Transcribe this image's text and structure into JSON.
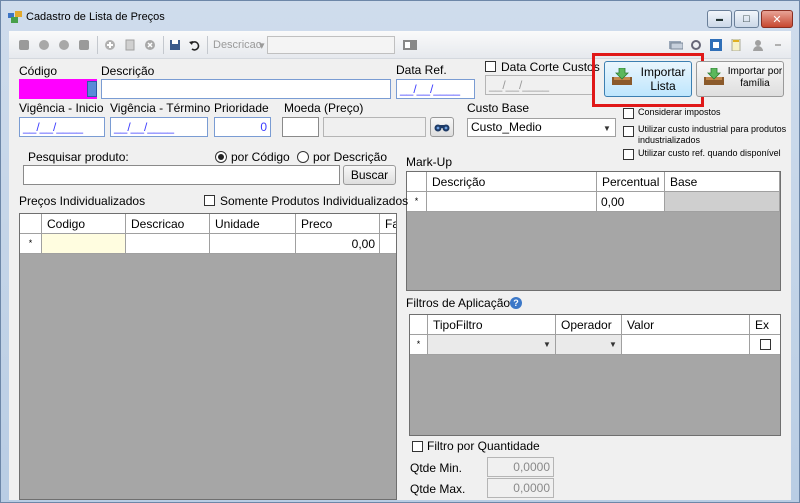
{
  "window": {
    "title": "Cadastro de Lista de Preços",
    "controls": {
      "minimize": "▬",
      "maximize": "□",
      "close": "✕"
    }
  },
  "toolbar": {
    "search_label": "Descricao",
    "search_dropdown_icon": "▾",
    "search_value": "",
    "icons": [
      "first-icon",
      "prev-icon",
      "next-icon",
      "last-icon",
      "add-icon",
      "edit-icon",
      "cancel-icon",
      "save-icon",
      "undo-icon",
      "filter-icon",
      "card-icon",
      "settings-icon",
      "refresh-icon",
      "report-icon",
      "user-icon",
      "ellipsis-icon"
    ]
  },
  "header": {
    "codigo_label": "Código",
    "codigo_value": "",
    "descricao_label": "Descrição",
    "descricao_value": "",
    "data_ref_label": "Data Ref.",
    "data_ref_value": "__/__/____",
    "data_corte_label": "Data Corte Custos",
    "data_corte_value": "__/__/____",
    "vigencia_inicio_label": "Vigência - Inicio",
    "vigencia_inicio_value": "__/__/____",
    "vigencia_termino_label": "Vigência - Término",
    "vigencia_termino_value": "__/__/____",
    "prioridade_label": "Prioridade",
    "prioridade_value": "0",
    "moeda_label": "Moeda (Preço)",
    "moeda_value": "",
    "custo_base_label": "Custo Base",
    "custo_base_value": "Custo_Medio"
  },
  "import_buttons": {
    "importar_lista": "Importar\nLista",
    "importar_familia": "Importar por\nfamília"
  },
  "options": {
    "considerar_impostos": "Considerar impostos",
    "custo_industrial": "Utilizar custo industrial para produtos industrializados",
    "custo_ref": "Utilizar custo ref. quando disponível"
  },
  "search": {
    "label": "Pesquisar produto:",
    "radio_codigo": "por Código",
    "radio_descricao": "por Descrição",
    "value": "",
    "button": "Buscar"
  },
  "precos": {
    "title": "Preços Individualizados",
    "somente_label": "Somente Produtos Individualizados",
    "columns": [
      "Codigo",
      "Descricao",
      "Unidade",
      "Preco",
      "Fa"
    ],
    "new_row": {
      "marker": "*",
      "preco": "0,00"
    }
  },
  "markup": {
    "title": "Mark-Up",
    "columns": [
      "Descrição",
      "Percentual",
      "Base"
    ],
    "new_row": {
      "marker": "*",
      "percentual": "0,00"
    }
  },
  "filtros": {
    "title": "Filtros de Aplicação",
    "help_icon": "?",
    "columns": [
      "TipoFiltro",
      "Operador",
      "Valor",
      "Ex"
    ],
    "new_row": {
      "marker": "*"
    }
  },
  "quantidade": {
    "filtro_label": "Filtro por Quantidade",
    "min_label": "Qtde Min.",
    "min_value": "0,0000",
    "max_label": "Qtde Max.",
    "max_value": "0,0000"
  },
  "colors": {
    "codigo_highlight": "#ff00ff",
    "import_highlight": "#e01818",
    "field_border": "#7a9cd3"
  }
}
